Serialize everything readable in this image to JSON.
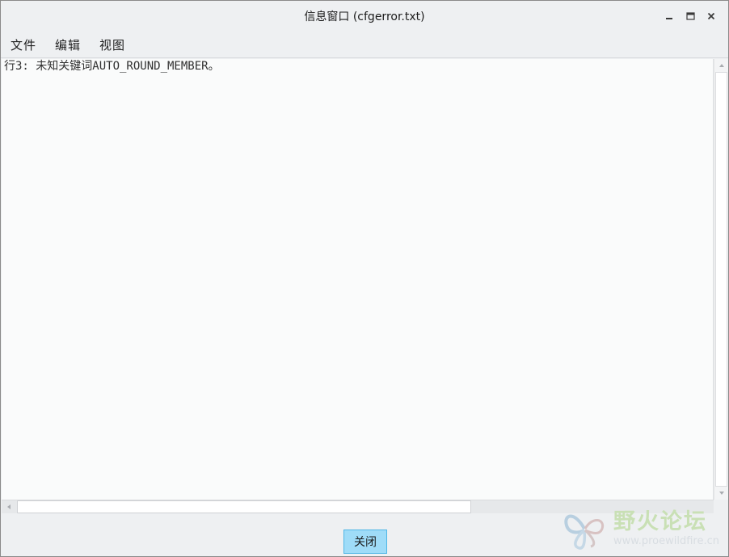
{
  "window": {
    "title": "信息窗口 (cfgerror.txt)"
  },
  "menubar": {
    "items": [
      {
        "label": "文件"
      },
      {
        "label": "编辑"
      },
      {
        "label": "视图"
      }
    ]
  },
  "content": {
    "lines": [
      "行3: 未知关键词AUTO_ROUND_MEMBER。"
    ]
  },
  "footer": {
    "close_label": "关闭"
  },
  "watermark": {
    "title": "野火论坛",
    "url": "www.proewildfire.cn"
  },
  "colors": {
    "close_button_bg": "#9fdcf8",
    "close_button_border": "#4fb6e6",
    "text_area_bg": "#fafbfb",
    "chrome_bg": "#eef0f2"
  }
}
